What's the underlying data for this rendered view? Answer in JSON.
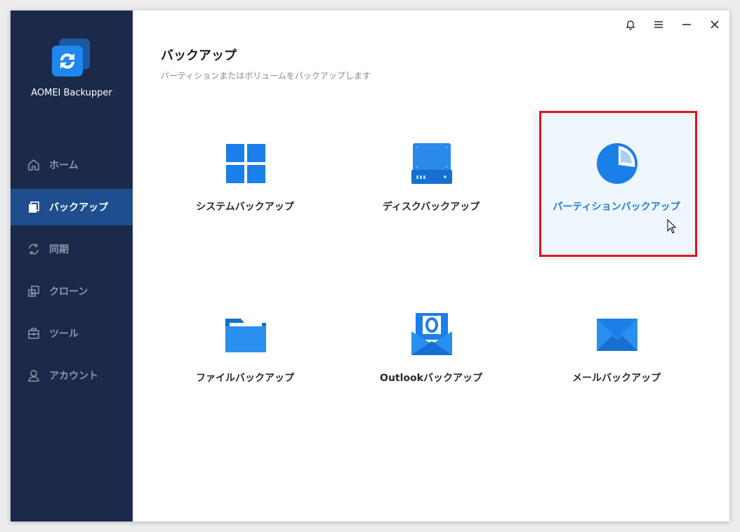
{
  "app": {
    "name": "AOMEI Backupper"
  },
  "sidebar": {
    "items": [
      {
        "label": "ホーム",
        "icon": "home-icon",
        "active": false
      },
      {
        "label": "バックアップ",
        "icon": "backup-icon",
        "active": true
      },
      {
        "label": "同期",
        "icon": "sync-icon",
        "active": false
      },
      {
        "label": "クローン",
        "icon": "clone-icon",
        "active": false
      },
      {
        "label": "ツール",
        "icon": "toolbox-icon",
        "active": false
      },
      {
        "label": "アカウント",
        "icon": "account-icon",
        "active": false
      }
    ]
  },
  "titlebar": {
    "buttons": [
      "bell-icon",
      "menu-icon",
      "minimize-icon",
      "close-icon"
    ]
  },
  "main": {
    "title": "バックアップ",
    "subtitle": "パーティションまたはボリュームをバックアップします",
    "options": [
      {
        "label": "システムバックアップ",
        "icon": "windows-logo-icon",
        "selected": false
      },
      {
        "label": "ディスクバックアップ",
        "icon": "disk-drive-icon",
        "selected": false
      },
      {
        "label": "パーティションバックアップ",
        "icon": "pie-chart-icon",
        "selected": true
      },
      {
        "label": "ファイルバックアップ",
        "icon": "folder-icon",
        "selected": false
      },
      {
        "label": "Outlookバックアップ",
        "icon": "outlook-icon",
        "selected": false
      },
      {
        "label": "メールバックアップ",
        "icon": "mail-envelope-icon",
        "selected": false
      }
    ]
  },
  "colors": {
    "sidebar_bg": "#1b2a4a",
    "sidebar_active": "#1e4e8e",
    "accent": "#1a80e6",
    "highlight": "#e0151f"
  }
}
